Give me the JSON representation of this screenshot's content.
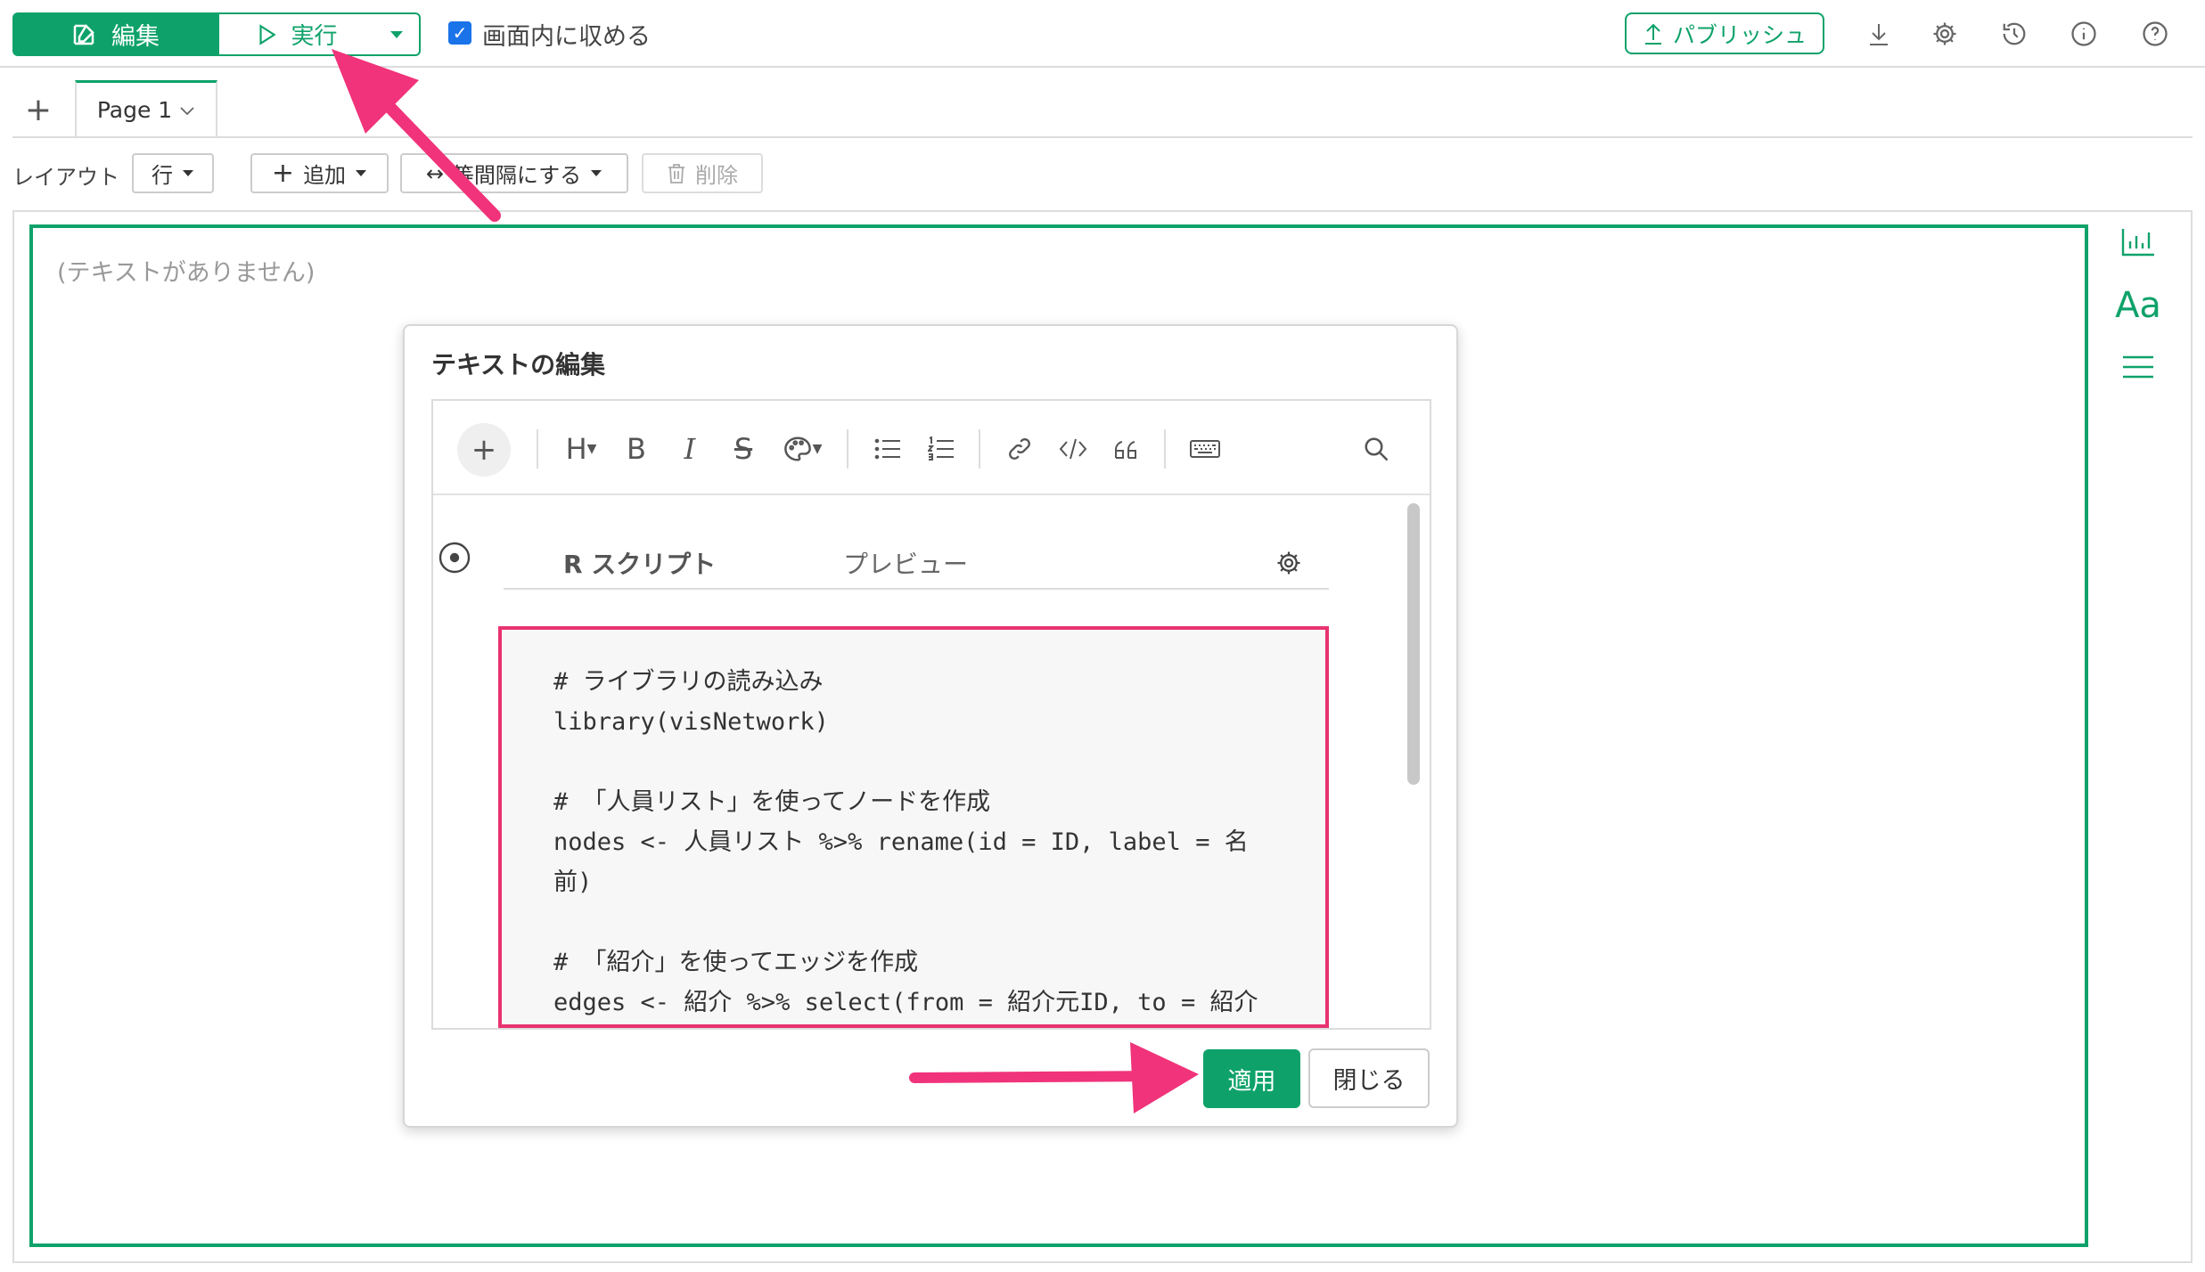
{
  "toolbar": {
    "edit_label": "編集",
    "run_label": "実行",
    "fit_checkbox_label": "画面内に収める",
    "fit_checkbox_checked": true,
    "publish_label": "パブリッシュ",
    "icons": [
      "download-icon",
      "gear-icon",
      "history-icon",
      "info-icon",
      "help-icon"
    ]
  },
  "tabs": {
    "add_label": "+",
    "pages": [
      {
        "label": "Page 1",
        "active": true
      }
    ]
  },
  "layout_bar": {
    "label": "レイアウト",
    "row_select": "行",
    "add_label": "追加",
    "equal_spacing_label": "等間隔にする",
    "delete_label": "削除"
  },
  "canvas": {
    "placeholder": "(テキストがありません)",
    "side_icons": [
      "chart-icon",
      "text-icon",
      "menu-icon"
    ],
    "side_text_glyph": "Aa"
  },
  "dialog": {
    "title": "テキストの編集",
    "editor_toolbar": [
      "add-block",
      "heading",
      "bold",
      "italic",
      "strikethrough",
      "color-palette",
      "bullet-list",
      "numbered-list",
      "link",
      "code",
      "quote",
      "keyboard",
      "search"
    ],
    "tab_r_script": "R スクリプト",
    "tab_preview": "プレビュー",
    "code_lines": [
      "# ライブラリの読み込み",
      "library(visNetwork)",
      "",
      "# 「人員リスト」を使ってノードを作成",
      "nodes <- 人員リスト %>% rename(id = ID, label = 名",
      "前)",
      "",
      "# 「紹介」を使ってエッジを作成",
      "edges <- 紹介 %>% select(from = 紹介元ID, to = 紹介"
    ],
    "apply_label": "適用",
    "close_label": "閉じる"
  },
  "colors": {
    "accent": "#0ea26a",
    "highlight": "#e8336f"
  }
}
